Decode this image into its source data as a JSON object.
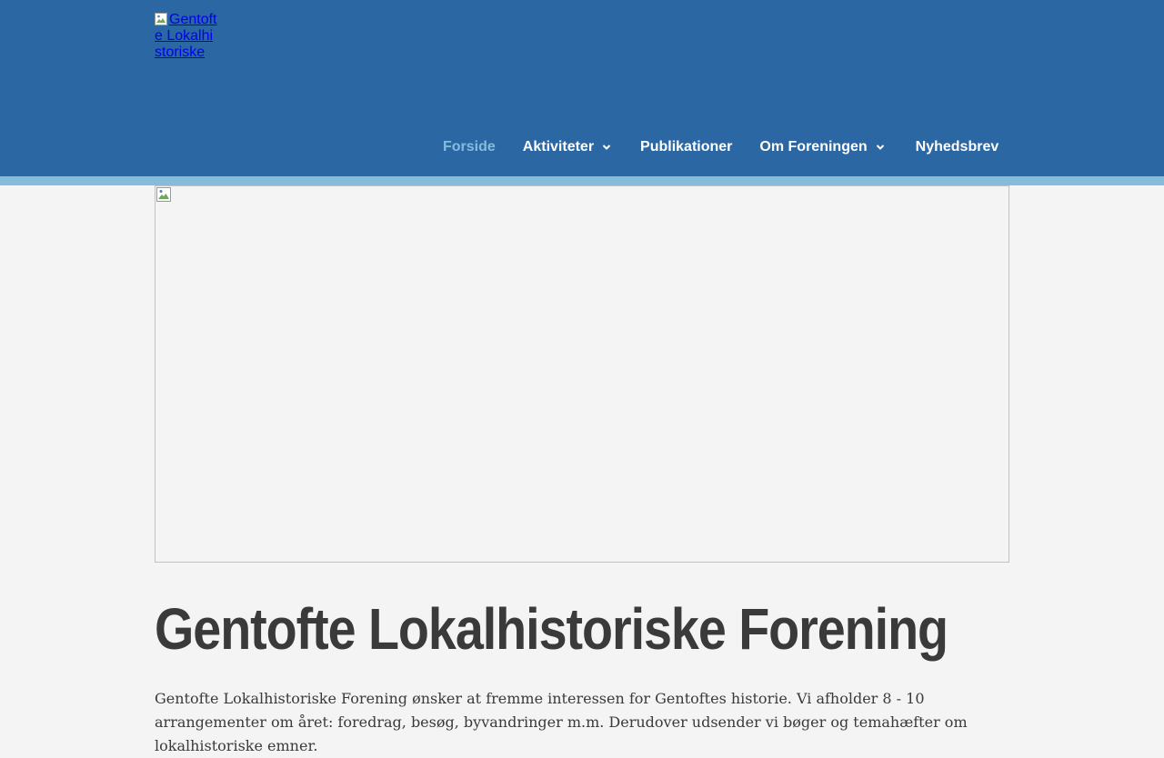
{
  "header": {
    "logo_alt": "Gentofte Lokalhistoriske",
    "colors": {
      "background": "#2b67a3",
      "strip": "#85bcdb",
      "active_nav": "#85bcdb"
    }
  },
  "nav": {
    "items": [
      {
        "label": "Forside",
        "active": true,
        "has_dropdown": false
      },
      {
        "label": "Aktiviteter",
        "active": false,
        "has_dropdown": true
      },
      {
        "label": "Publikationer",
        "active": false,
        "has_dropdown": false
      },
      {
        "label": "Om Foreningen",
        "active": false,
        "has_dropdown": true
      },
      {
        "label": "Nyhedsbrev",
        "active": false,
        "has_dropdown": false
      }
    ]
  },
  "main": {
    "title": "Gentofte Lokalhistoriske Forening",
    "intro": "Gentofte Lokalhistoriske Forening ønsker at fremme interessen for Gentoftes historie. Vi afholder 8 - 10 arrangementer om året: foredrag, besøg, byvandringer m.m. Derudover udsender vi bøger og temahæfter om lokalhistoriske emner."
  }
}
